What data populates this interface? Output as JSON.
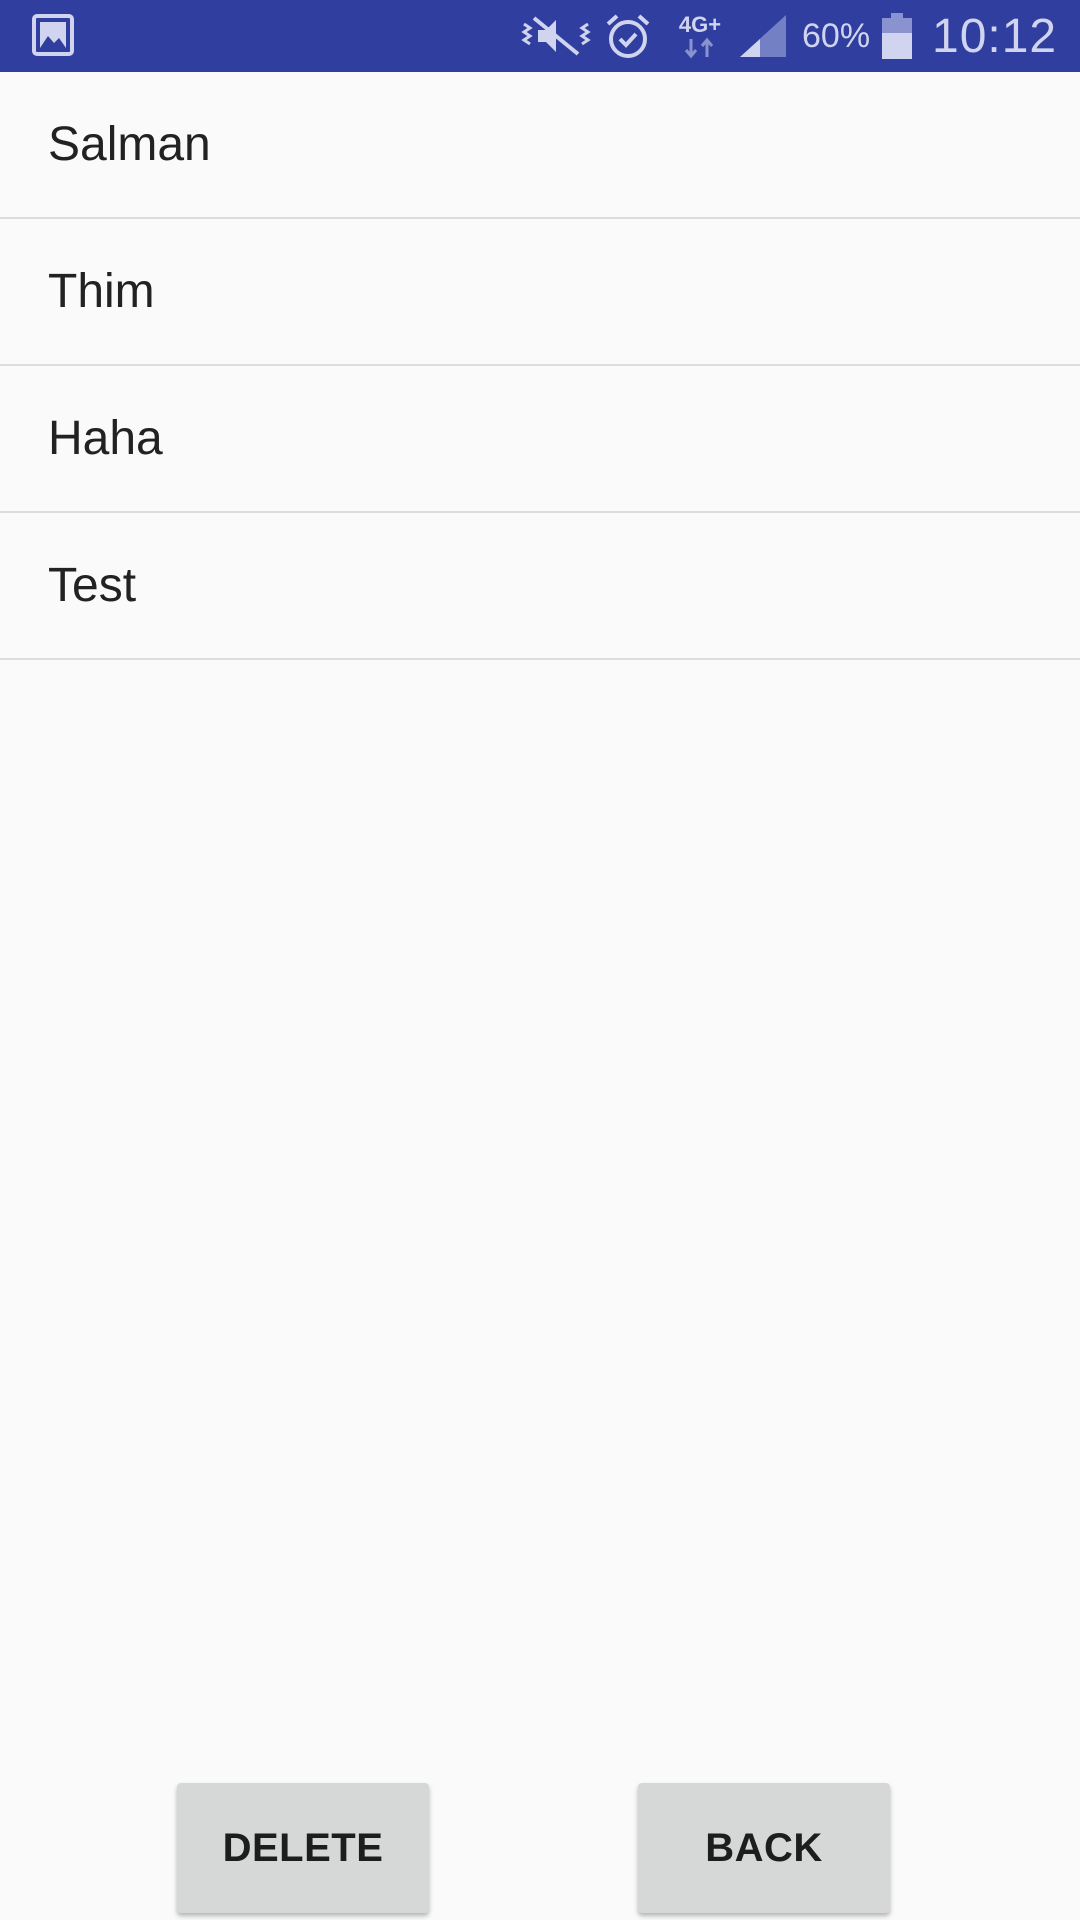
{
  "status_bar": {
    "network_type": "4G+",
    "battery_percent": "60%",
    "time": "10:12",
    "icons": [
      "gallery-icon",
      "vibrate-icon",
      "alarm-icon",
      "data-transfer-icon",
      "signal-icon",
      "battery-icon"
    ],
    "background_color": "#303f9f"
  },
  "list": {
    "items": [
      {
        "label": "Salman"
      },
      {
        "label": "Thim"
      },
      {
        "label": "Haha"
      },
      {
        "label": "Test"
      }
    ]
  },
  "actions": {
    "delete_label": "DELETE",
    "back_label": "BACK"
  }
}
